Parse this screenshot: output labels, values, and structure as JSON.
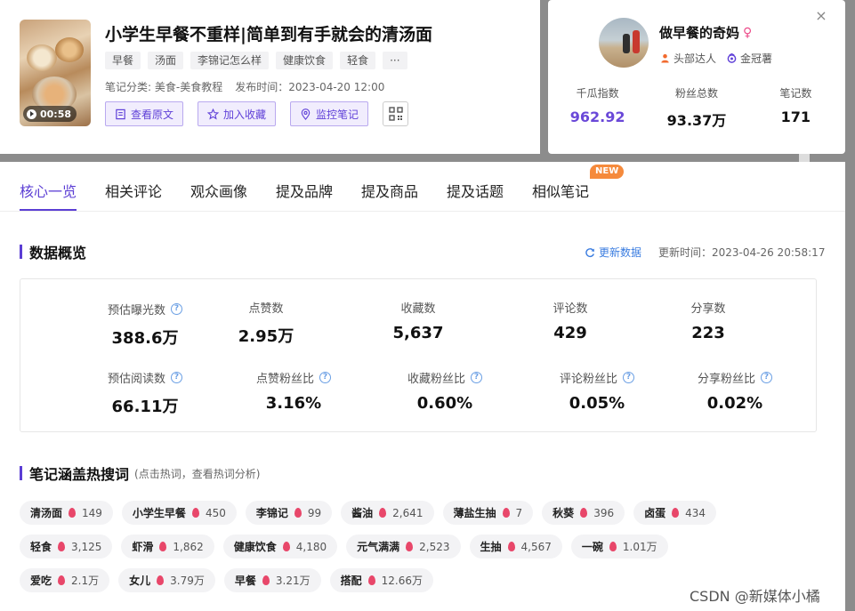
{
  "note": {
    "duration": "00:58",
    "title": "小学生早餐不重样|简单到有手就会的清汤面",
    "tags": [
      "早餐",
      "汤面",
      "李锦记怎么样",
      "健康饮食",
      "轻食",
      "···"
    ],
    "category": "笔记分类: 美食-美食教程",
    "published": "发布时间：2023-04-20 12:00",
    "actions": {
      "view": "查看原文",
      "collect": "加入收藏",
      "monitor": "监控笔记"
    }
  },
  "author": {
    "name": "做早餐的奇妈",
    "gender_symbol": "♀",
    "badge1": "头部达人",
    "badge2": "金冠薯",
    "close": "×",
    "stats": [
      {
        "label": "千瓜指数",
        "value": "962.92"
      },
      {
        "label": "粉丝总数",
        "value": "93.37万"
      },
      {
        "label": "笔记数",
        "value": "171"
      }
    ]
  },
  "tabs": {
    "items": [
      "核心一览",
      "相关评论",
      "观众画像",
      "提及品牌",
      "提及商品",
      "提及话题",
      "相似笔记"
    ],
    "new_badge": "NEW"
  },
  "overview": {
    "title": "数据概览",
    "refresh": "更新数据",
    "updated": "更新时间：2023-04-26 20:58:17",
    "row1": [
      {
        "label": "预估曝光数",
        "value": "388.6万"
      },
      {
        "label": "点赞数",
        "value": "2.95万"
      },
      {
        "label": "收藏数",
        "value": "5,637"
      },
      {
        "label": "评论数",
        "value": "429"
      },
      {
        "label": "分享数",
        "value": "223"
      }
    ],
    "row2": [
      {
        "label": "预估阅读数",
        "value": "66.11万"
      },
      {
        "label": "点赞粉丝比",
        "value": "3.16%"
      },
      {
        "label": "收藏粉丝比",
        "value": "0.60%"
      },
      {
        "label": "评论粉丝比",
        "value": "0.05%"
      },
      {
        "label": "分享粉丝比",
        "value": "0.02%"
      }
    ]
  },
  "keywords": {
    "title": "笔记涵盖热搜词",
    "subtitle": "(点击热词，查看热词分析)",
    "rows": [
      [
        {
          "word": "清汤面",
          "count": "149"
        },
        {
          "word": "小学生早餐",
          "count": "450"
        },
        {
          "word": "李锦记",
          "count": "99"
        },
        {
          "word": "酱油",
          "count": "2,641"
        },
        {
          "word": "薄盐生抽",
          "count": "7"
        },
        {
          "word": "秋葵",
          "count": "396"
        },
        {
          "word": "卤蛋",
          "count": "434"
        }
      ],
      [
        {
          "word": "轻食",
          "count": "3,125"
        },
        {
          "word": "虾滑",
          "count": "1,862"
        },
        {
          "word": "健康饮食",
          "count": "4,180"
        },
        {
          "word": "元气满满",
          "count": "2,523"
        },
        {
          "word": "生抽",
          "count": "4,567"
        },
        {
          "word": "一碗",
          "count": "1.01万"
        }
      ],
      [
        {
          "word": "爱吃",
          "count": "2.1万"
        },
        {
          "word": "女儿",
          "count": "3.79万"
        },
        {
          "word": "早餐",
          "count": "3.21万"
        },
        {
          "word": "搭配",
          "count": "12.66万"
        }
      ]
    ]
  },
  "watermark": "CSDN @新媒体小橘"
}
